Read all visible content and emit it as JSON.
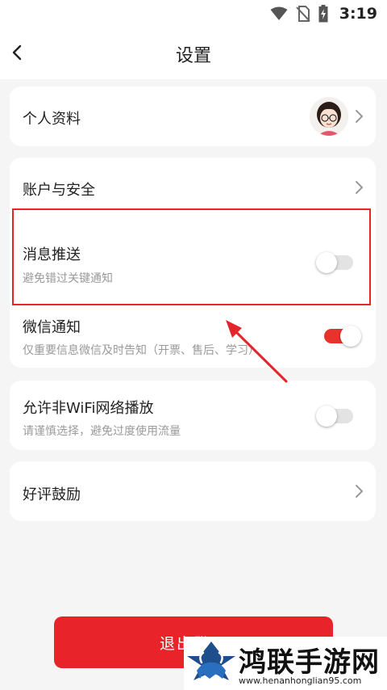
{
  "status_bar": {
    "time": "3:19",
    "icons": [
      "wifi-icon",
      "no-sim-icon",
      "battery-charging-icon"
    ]
  },
  "header": {
    "title": "设置",
    "back_icon": "chevron-left-icon"
  },
  "settings": {
    "profile": {
      "label": "个人资料"
    },
    "account": {
      "label": "账户与安全"
    },
    "push": {
      "label": "消息推送",
      "subtitle": "避免错过关键通知",
      "enabled": false
    },
    "wechat": {
      "label": "微信通知",
      "subtitle": "仅重要信息微信及时告知（开票、售后、学习）",
      "enabled": true
    },
    "non_wifi": {
      "label": "允许非WiFi网络播放",
      "subtitle": "请谨慎选择，避免过度使用流量",
      "enabled": false
    },
    "rate": {
      "label": "好评鼓励"
    }
  },
  "logout": {
    "label": "退出登录"
  },
  "watermark": {
    "name": "鸿联手游网",
    "url": "www.henanhonglian95.com"
  },
  "colors": {
    "accent": "#e8332d",
    "annotation": "#e4262b",
    "background": "#f5f5f5"
  }
}
